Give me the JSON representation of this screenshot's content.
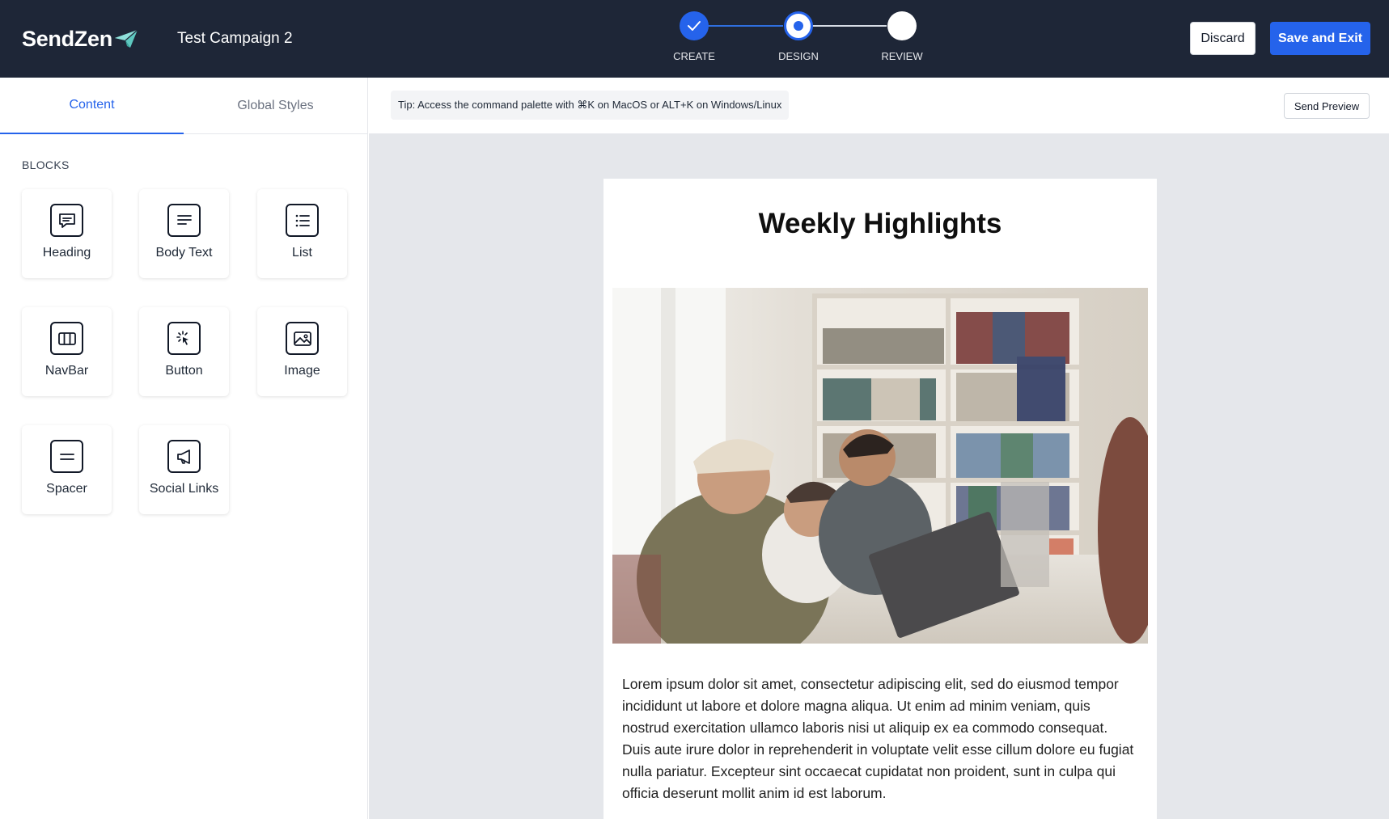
{
  "header": {
    "brand": "SendZen",
    "campaign_name": "Test Campaign 2",
    "steps": [
      {
        "label": "CREATE",
        "state": "completed"
      },
      {
        "label": "DESIGN",
        "state": "current"
      },
      {
        "label": "REVIEW",
        "state": "upcoming"
      }
    ],
    "discard_label": "Discard",
    "save_label": "Save and Exit",
    "colors": {
      "background": "#1e2637",
      "accent": "#2563eb"
    }
  },
  "sidebar": {
    "tabs": [
      {
        "label": "Content",
        "active": true
      },
      {
        "label": "Global Styles",
        "active": false
      }
    ],
    "blocks_title": "BLOCKS",
    "blocks": [
      {
        "label": "Heading",
        "icon": "heading-icon"
      },
      {
        "label": "Body Text",
        "icon": "body-text-icon"
      },
      {
        "label": "List",
        "icon": "list-icon"
      },
      {
        "label": "NavBar",
        "icon": "navbar-icon"
      },
      {
        "label": "Button",
        "icon": "button-icon"
      },
      {
        "label": "Image",
        "icon": "image-icon"
      },
      {
        "label": "Spacer",
        "icon": "spacer-icon"
      },
      {
        "label": "Social Links",
        "icon": "social-links-icon"
      }
    ]
  },
  "toolbar": {
    "tip": "Tip: Access the command palette with ⌘K on MacOS or ALT+K on Windows/Linux",
    "send_preview_label": "Send Preview"
  },
  "email": {
    "heading": "Weekly Highlights",
    "image_alt": "team-laughing-at-laptop-photo",
    "body": "Lorem ipsum dolor sit amet, consectetur adipiscing elit, sed do eiusmod tempor incididunt ut labore et dolore magna aliqua. Ut enim ad minim veniam, quis nostrud exercitation ullamco laboris nisi ut aliquip ex ea commodo consequat. Duis aute irure dolor in reprehenderit in voluptate velit esse cillum dolore eu fugiat nulla pariatur. Excepteur sint occaecat cupidatat non proident, sunt in culpa qui officia deserunt mollit anim id est laborum."
  }
}
